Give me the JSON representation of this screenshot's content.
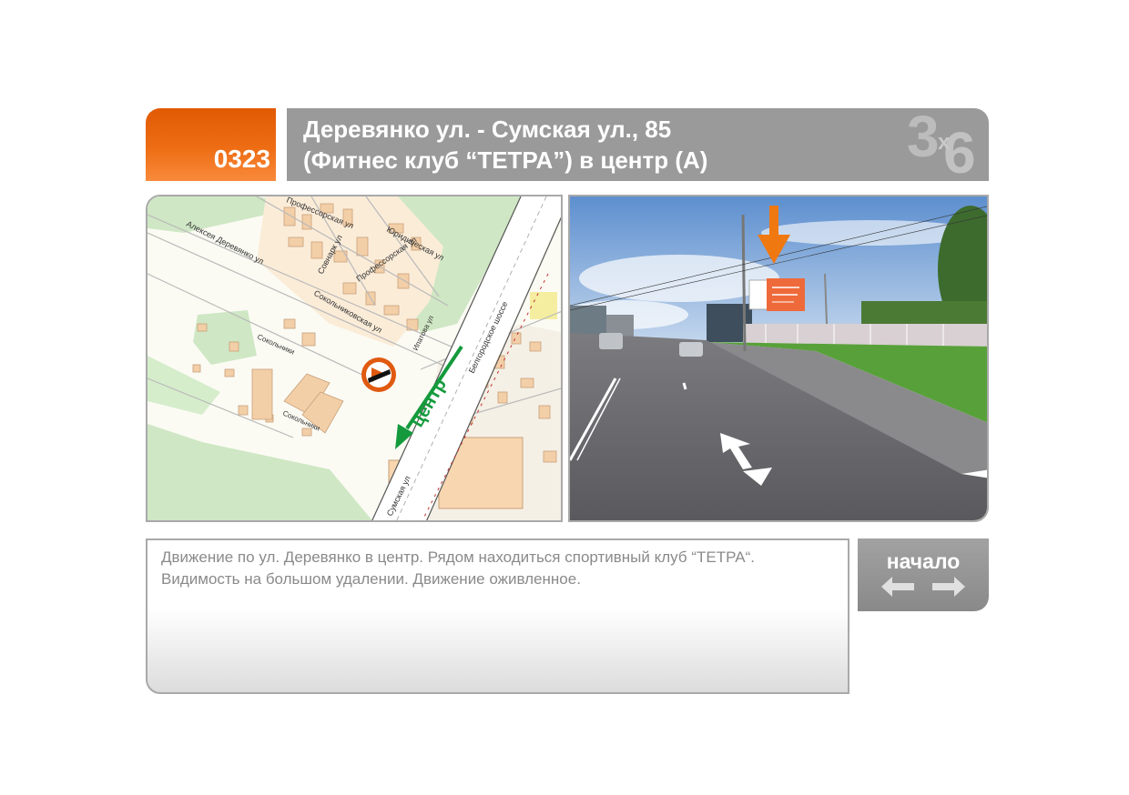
{
  "header": {
    "code": "0323",
    "title_line1": "Деревянко ул. - Сумская ул., 85",
    "title_line2": "(Фитнес клуб “ТЕТРА”) в центр (А)",
    "format": {
      "a": "3",
      "x": "x",
      "b": "6"
    }
  },
  "map": {
    "streets": {
      "derevyanko": "Алексея Деревянко ул",
      "professorskaya1": "Профессорская ул",
      "professorskaya2": "Профессорская ул",
      "sovnarkomovskaya": "Совнарк ул",
      "yuridicheskaya": "Юридическая ул",
      "sokolnikovskaya": "Сокольниковская ул",
      "sokolniki": "Сокольники",
      "sokolniki2": "Сокольники",
      "belgorodskoe": "Белгородское шоссе",
      "ipatova": "Ипатова ул",
      "sumskaya": "Сумская ул"
    },
    "direction_label": "центр"
  },
  "description": "Движение по ул. Деревянко в центр. Рядом находиться спортивный клуб “ТЕТРА“. Видимость на большом удалении. Движение оживленное.",
  "nav": {
    "label": "начало"
  },
  "colors": {
    "accent": "#e8600a",
    "header_gray": "#9a9a9a",
    "route_green": "#149a3c"
  }
}
